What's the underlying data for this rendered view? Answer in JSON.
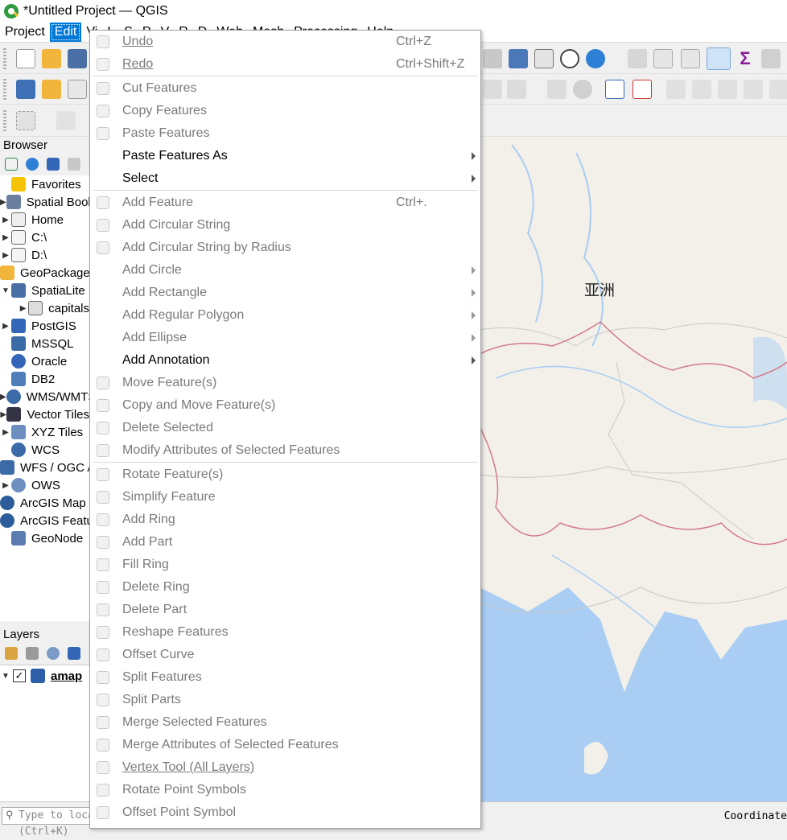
{
  "window": {
    "title": "*Untitled Project — QGIS"
  },
  "menubar": [
    {
      "label": "Project",
      "active": false
    },
    {
      "label": "Edit",
      "active": true
    },
    {
      "label": "Vi",
      "active": false
    },
    {
      "label": "L",
      "active": false
    },
    {
      "label": "S",
      "active": false
    },
    {
      "label": "P",
      "active": false
    },
    {
      "label": "V",
      "active": false
    },
    {
      "label": "R",
      "active": false
    },
    {
      "label": "D",
      "active": false
    },
    {
      "label": "Web",
      "active": false
    },
    {
      "label": "Mesh",
      "active": false
    },
    {
      "label": "Processing",
      "active": false
    },
    {
      "label": "Help",
      "active": false
    }
  ],
  "browser": {
    "title": "Browser",
    "items": [
      {
        "label": "Favorites",
        "arrow": "",
        "icon": "star-icon"
      },
      {
        "label": "Spatial Bookmarks",
        "arrow": "▶",
        "icon": "bookmark-icon"
      },
      {
        "label": "Home",
        "arrow": "▶",
        "icon": "home-icon"
      },
      {
        "label": "C:\\",
        "arrow": "▶",
        "icon": "folder-icon"
      },
      {
        "label": "D:\\",
        "arrow": "▶",
        "icon": "folder-icon"
      },
      {
        "label": "GeoPackage",
        "arrow": "",
        "icon": "geopackage-icon"
      },
      {
        "label": "SpatiaLite",
        "arrow": "▼",
        "icon": "feather-icon"
      },
      {
        "label": "capitals",
        "arrow": "▶",
        "icon": "database-icon",
        "indent": true
      },
      {
        "label": "PostGIS",
        "arrow": "▶",
        "icon": "elephant-icon"
      },
      {
        "label": "MSSQL",
        "arrow": "",
        "icon": "mssql-icon"
      },
      {
        "label": "Oracle",
        "arrow": "",
        "icon": "oracle-icon"
      },
      {
        "label": "DB2",
        "arrow": "",
        "icon": "db2-icon"
      },
      {
        "label": "WMS/WMTS",
        "arrow": "▶",
        "icon": "globe-icon"
      },
      {
        "label": "Vector Tiles",
        "arrow": "▶",
        "icon": "grid-icon"
      },
      {
        "label": "XYZ Tiles",
        "arrow": "▶",
        "icon": "tiles-icon"
      },
      {
        "label": "WCS",
        "arrow": "",
        "icon": "globe-icon"
      },
      {
        "label": "WFS / OGC API",
        "arrow": "",
        "icon": "wfs-icon"
      },
      {
        "label": "OWS",
        "arrow": "▶",
        "icon": "globe-outline-icon"
      },
      {
        "label": "ArcGIS Map Service",
        "arrow": "",
        "icon": "arcgis-icon"
      },
      {
        "label": "ArcGIS Feature Service",
        "arrow": "",
        "icon": "arcgis-icon"
      },
      {
        "label": "GeoNode",
        "arrow": "",
        "icon": "geonode-icon"
      }
    ]
  },
  "layers": {
    "title": "Layers",
    "items": [
      {
        "label": "amap",
        "checked": true
      }
    ]
  },
  "status": {
    "locator_placeholder": "Type to locate (Ctrl+K)",
    "coordinate_label": "Coordinate"
  },
  "map": {
    "label": "亚洲"
  },
  "edit_menu": [
    {
      "label": "Undo",
      "shortcut": "Ctrl+Z",
      "disabled": true,
      "submenu": false,
      "underline": true,
      "icon": "undo-icon"
    },
    {
      "label": "Redo",
      "shortcut": "Ctrl+Shift+Z",
      "disabled": true,
      "submenu": false,
      "underline": true,
      "icon": "redo-icon"
    },
    {
      "separator": true
    },
    {
      "label": "Cut Features",
      "shortcut": "",
      "disabled": true,
      "submenu": false,
      "icon": "scissors-icon"
    },
    {
      "label": "Copy Features",
      "shortcut": "",
      "disabled": true,
      "submenu": false,
      "icon": "copy-icon"
    },
    {
      "label": "Paste Features",
      "shortcut": "",
      "disabled": true,
      "submenu": false,
      "icon": "paste-icon"
    },
    {
      "label": "Paste Features As",
      "shortcut": "",
      "disabled": false,
      "submenu": true,
      "icon": ""
    },
    {
      "label": "Select",
      "shortcut": "",
      "disabled": false,
      "submenu": true,
      "icon": ""
    },
    {
      "separator": true
    },
    {
      "label": "Add Feature",
      "shortcut": "Ctrl+.",
      "disabled": true,
      "submenu": false,
      "icon": "add-feature-icon"
    },
    {
      "label": "Add Circular String",
      "shortcut": "",
      "disabled": true,
      "submenu": false,
      "icon": "circular-string-icon"
    },
    {
      "label": "Add Circular String by Radius",
      "shortcut": "",
      "disabled": true,
      "submenu": false,
      "icon": "circular-string-radius-icon"
    },
    {
      "label": "Add Circle",
      "shortcut": "",
      "disabled": true,
      "submenu": true,
      "icon": ""
    },
    {
      "label": "Add Rectangle",
      "shortcut": "",
      "disabled": true,
      "submenu": true,
      "icon": ""
    },
    {
      "label": "Add Regular Polygon",
      "shortcut": "",
      "disabled": true,
      "submenu": true,
      "icon": ""
    },
    {
      "label": "Add Ellipse",
      "shortcut": "",
      "disabled": true,
      "submenu": true,
      "icon": ""
    },
    {
      "label": "Add Annotation",
      "shortcut": "",
      "disabled": false,
      "submenu": true,
      "icon": ""
    },
    {
      "label": "Move Feature(s)",
      "shortcut": "",
      "disabled": true,
      "submenu": false,
      "icon": "move-feature-icon"
    },
    {
      "label": "Copy and Move Feature(s)",
      "shortcut": "",
      "disabled": true,
      "submenu": false,
      "icon": "copy-move-feature-icon"
    },
    {
      "label": "Delete Selected",
      "shortcut": "",
      "disabled": true,
      "submenu": false,
      "icon": "trash-icon"
    },
    {
      "label": "Modify Attributes of Selected Features",
      "shortcut": "",
      "disabled": true,
      "submenu": false,
      "icon": "modify-attributes-icon"
    },
    {
      "separator": true
    },
    {
      "label": "Rotate Feature(s)",
      "shortcut": "",
      "disabled": true,
      "submenu": false,
      "icon": "rotate-feature-icon"
    },
    {
      "label": "Simplify Feature",
      "shortcut": "",
      "disabled": true,
      "submenu": false,
      "icon": "simplify-icon"
    },
    {
      "label": "Add Ring",
      "shortcut": "",
      "disabled": true,
      "submenu": false,
      "icon": "add-ring-icon"
    },
    {
      "label": "Add Part",
      "shortcut": "",
      "disabled": true,
      "submenu": false,
      "icon": "add-part-icon"
    },
    {
      "label": "Fill Ring",
      "shortcut": "",
      "disabled": true,
      "submenu": false,
      "icon": "fill-ring-icon"
    },
    {
      "label": "Delete Ring",
      "shortcut": "",
      "disabled": true,
      "submenu": false,
      "icon": "delete-ring-icon"
    },
    {
      "label": "Delete Part",
      "shortcut": "",
      "disabled": true,
      "submenu": false,
      "icon": "delete-part-icon"
    },
    {
      "label": "Reshape Features",
      "shortcut": "",
      "disabled": true,
      "submenu": false,
      "icon": "reshape-icon"
    },
    {
      "label": "Offset Curve",
      "shortcut": "",
      "disabled": true,
      "submenu": false,
      "icon": "offset-curve-icon"
    },
    {
      "label": "Split Features",
      "shortcut": "",
      "disabled": true,
      "submenu": false,
      "icon": "split-features-icon"
    },
    {
      "label": "Split Parts",
      "shortcut": "",
      "disabled": true,
      "submenu": false,
      "icon": "split-parts-icon"
    },
    {
      "label": "Merge Selected Features",
      "shortcut": "",
      "disabled": true,
      "submenu": false,
      "icon": "merge-features-icon"
    },
    {
      "label": "Merge Attributes of Selected Features",
      "shortcut": "",
      "disabled": true,
      "submenu": false,
      "icon": "merge-attributes-icon"
    },
    {
      "label": "Vertex Tool (All Layers)",
      "shortcut": "",
      "disabled": true,
      "submenu": false,
      "underline": true,
      "icon": "vertex-tool-icon"
    },
    {
      "label": "Rotate Point Symbols",
      "shortcut": "",
      "disabled": true,
      "submenu": false,
      "icon": "rotate-point-icon"
    },
    {
      "label": "Offset Point Symbol",
      "shortcut": "",
      "disabled": true,
      "submenu": false,
      "icon": "offset-point-icon"
    }
  ],
  "colors": {
    "menu_highlight": "#0078d7",
    "map_land": "#f3f0ea",
    "map_water": "#a9cdf3",
    "map_border": "#d37a86"
  }
}
